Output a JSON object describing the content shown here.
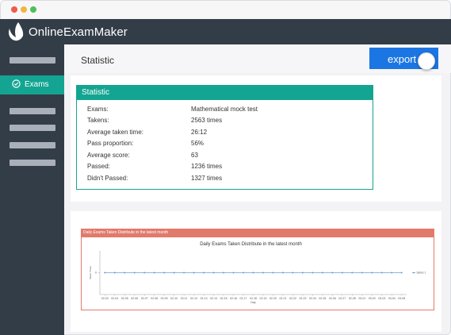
{
  "app": {
    "name": "OnlineExamMaker"
  },
  "sidebar": {
    "active_item": "Exams"
  },
  "header": {
    "title": "Statistic",
    "export_label": "export"
  },
  "statistic": {
    "title": "Statistic",
    "rows": [
      {
        "label": "Exams:",
        "value": "Mathematical mock test"
      },
      {
        "label": "Takens:",
        "value": "2563 times"
      },
      {
        "label": "Average taken time:",
        "value": "26:12"
      },
      {
        "label": "Pass proportion:",
        "value": "56%"
      },
      {
        "label": "Average score:",
        "value": "63"
      },
      {
        "label": "Passed:",
        "value": "1236 times"
      },
      {
        "label": "Didn't Passed:",
        "value": "1327 times"
      }
    ]
  },
  "chart_panel": {
    "title": "Daily Exams Taken Distribute in the latest month"
  },
  "chart_data": {
    "type": "line",
    "title": "Daily Exams Taken Distribute in the latest month",
    "xlabel": "Day",
    "ylabel": "Taken Times",
    "categories": [
      "02-03",
      "02-04",
      "02-05",
      "02-06",
      "02-07",
      "02-08",
      "02-09",
      "02-10",
      "02-11",
      "02-12",
      "02-13",
      "02-14",
      "02-15",
      "02-16",
      "02-17",
      "02-18",
      "02-19",
      "02-20",
      "02-21",
      "02-22",
      "02-23",
      "02-24",
      "02-25",
      "02-26",
      "02-27",
      "02-28",
      "03-01",
      "03-02",
      "03-03",
      "03-04",
      "03-05"
    ],
    "series": [
      {
        "name": "Series 1",
        "values": [
          0,
          0,
          0,
          0,
          0,
          0,
          0,
          0,
          0,
          0,
          0,
          0,
          0,
          0,
          0,
          0,
          0,
          0,
          0,
          0,
          0,
          0,
          0,
          0,
          0,
          0,
          0,
          0,
          0,
          0,
          0
        ]
      }
    ],
    "yticks": [
      0
    ],
    "ylim": [
      0,
      1
    ],
    "grid": false,
    "legend": "right",
    "line_color": "#6d9bd3"
  }
}
